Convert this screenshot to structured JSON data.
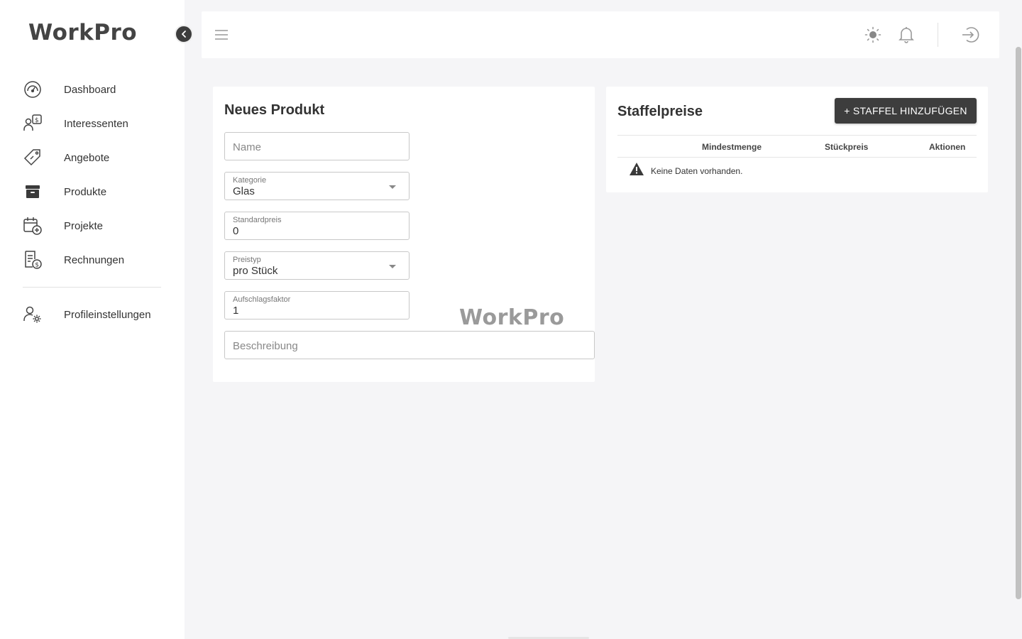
{
  "app": {
    "logo": "WorkPro",
    "watermark": "WorkPro"
  },
  "sidebar": {
    "items": [
      {
        "label": "Dashboard",
        "icon": "dashboard-icon"
      },
      {
        "label": "Interessenten",
        "icon": "leads-icon"
      },
      {
        "label": "Angebote",
        "icon": "offers-tag-icon"
      },
      {
        "label": "Produkte",
        "icon": "archive-box-icon"
      },
      {
        "label": "Projekte",
        "icon": "calendar-add-icon"
      },
      {
        "label": "Rechnungen",
        "icon": "invoice-icon"
      }
    ],
    "secondary": [
      {
        "label": "Profileinstellungen",
        "icon": "user-settings-icon"
      }
    ]
  },
  "topbar": {
    "icons": [
      "menu-icon",
      "sun-icon",
      "bell-icon",
      "logout-icon"
    ]
  },
  "product_form": {
    "title": "Neues Produkt",
    "name": {
      "placeholder": "Name",
      "value": ""
    },
    "category": {
      "label": "Kategorie",
      "value": "Glas"
    },
    "standard_price": {
      "label": "Standardpreis",
      "value": "0"
    },
    "price_type": {
      "label": "Preistyp",
      "value": "pro Stück"
    },
    "markup_factor": {
      "label": "Aufschlagsfaktor",
      "value": "1"
    },
    "description": {
      "placeholder": "Beschreibung",
      "value": ""
    }
  },
  "tier_pricing": {
    "title": "Staffelpreise",
    "add_button": "+ STAFFEL HINZUFÜGEN",
    "columns": [
      "Mindestmenge",
      "Stückpreis",
      "Aktionen"
    ],
    "empty_text": "Keine Daten vorhanden.",
    "rows": []
  },
  "colors": {
    "background": "#f5f5f7",
    "surface": "#ffffff",
    "primary_button": "#3d3d3d",
    "text": "#333333"
  }
}
